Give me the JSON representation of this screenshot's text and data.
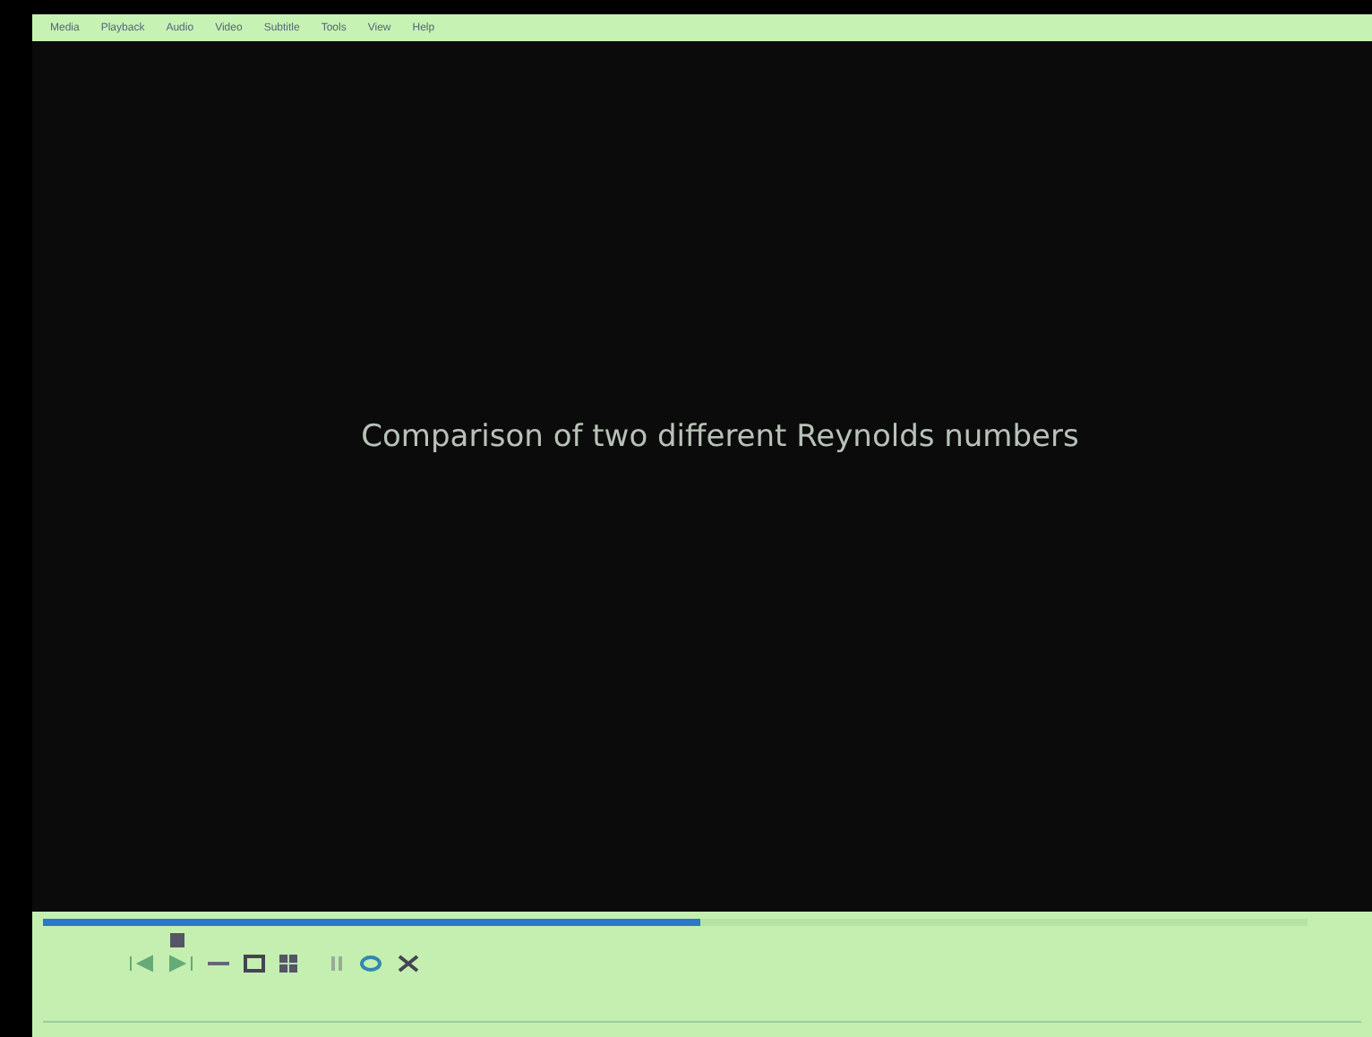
{
  "menu": [
    "Media",
    "Playback",
    "Audio",
    "Video",
    "Subtitle",
    "Tools",
    "View",
    "Help"
  ],
  "video": {
    "caption": "Comparison of two different Reynolds numbers"
  },
  "seek": {
    "level": 0.52
  }
}
